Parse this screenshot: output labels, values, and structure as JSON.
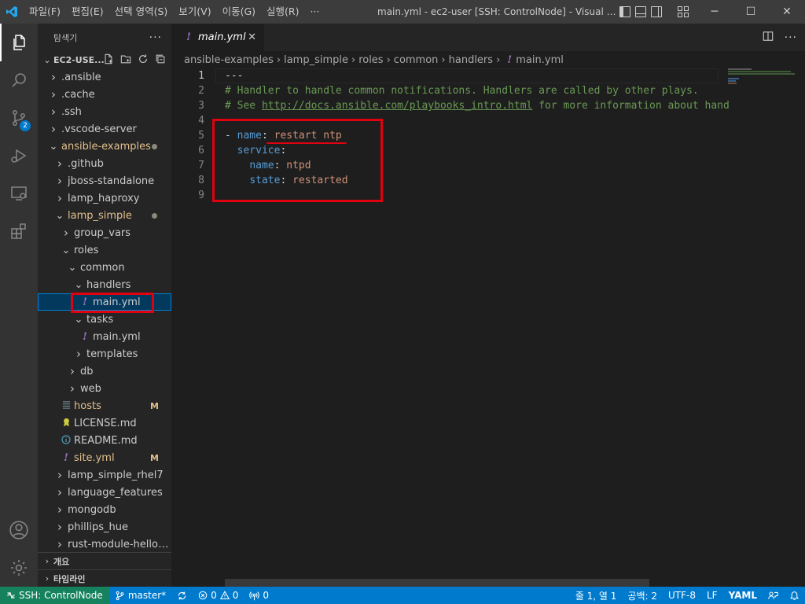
{
  "window": {
    "title": "main.yml - ec2-user [SSH: ControlNode] - Visual St...",
    "menus": [
      "파일(F)",
      "편집(E)",
      "선택 영역(S)",
      "보기(V)",
      "이동(G)",
      "실행(R)",
      "···"
    ],
    "controls": {
      "minimize": "─",
      "maximize": "☐",
      "close": "✕"
    }
  },
  "activity": {
    "source_control_badge": "2"
  },
  "sidebar": {
    "title": "탐색기",
    "more": "···",
    "folder": "EC2-USE...",
    "tree": [
      {
        "label": ".ansible",
        "depth": 0,
        "kind": "folder",
        "open": false
      },
      {
        "label": ".cache",
        "depth": 0,
        "kind": "folder",
        "open": false
      },
      {
        "label": ".ssh",
        "depth": 0,
        "kind": "folder",
        "open": false
      },
      {
        "label": ".vscode-server",
        "depth": 0,
        "kind": "folder",
        "open": false
      },
      {
        "label": "ansible-examples",
        "depth": 0,
        "kind": "folder",
        "open": true,
        "modified": true,
        "dot": true
      },
      {
        "label": ".github",
        "depth": 1,
        "kind": "folder",
        "open": false
      },
      {
        "label": "jboss-standalone",
        "depth": 1,
        "kind": "folder",
        "open": false
      },
      {
        "label": "lamp_haproxy",
        "depth": 1,
        "kind": "folder",
        "open": false
      },
      {
        "label": "lamp_simple",
        "depth": 1,
        "kind": "folder",
        "open": true,
        "modified": true,
        "dot": true
      },
      {
        "label": "group_vars",
        "depth": 2,
        "kind": "folder",
        "open": false
      },
      {
        "label": "roles",
        "depth": 2,
        "kind": "folder",
        "open": true
      },
      {
        "label": "common",
        "depth": 3,
        "kind": "folder",
        "open": true
      },
      {
        "label": "handlers",
        "depth": 4,
        "kind": "folder",
        "open": true
      },
      {
        "label": "main.yml",
        "depth": 5,
        "kind": "yaml",
        "selected": true
      },
      {
        "label": "tasks",
        "depth": 4,
        "kind": "folder",
        "open": true
      },
      {
        "label": "main.yml",
        "depth": 5,
        "kind": "yaml"
      },
      {
        "label": "templates",
        "depth": 4,
        "kind": "folder",
        "open": false
      },
      {
        "label": "db",
        "depth": 3,
        "kind": "folder",
        "open": false
      },
      {
        "label": "web",
        "depth": 3,
        "kind": "folder",
        "open": false
      },
      {
        "label": "hosts",
        "depth": 2,
        "kind": "hosts",
        "modified": true,
        "status": "M"
      },
      {
        "label": "LICENSE.md",
        "depth": 2,
        "kind": "license"
      },
      {
        "label": "README.md",
        "depth": 2,
        "kind": "info"
      },
      {
        "label": "site.yml",
        "depth": 2,
        "kind": "yaml",
        "modified": true,
        "status": "M"
      },
      {
        "label": "lamp_simple_rhel7",
        "depth": 1,
        "kind": "folder",
        "open": false
      },
      {
        "label": "language_features",
        "depth": 1,
        "kind": "folder",
        "open": false
      },
      {
        "label": "mongodb",
        "depth": 1,
        "kind": "folder",
        "open": false
      },
      {
        "label": "phillips_hue",
        "depth": 1,
        "kind": "folder",
        "open": false
      },
      {
        "label": "rust-module-hello-...",
        "depth": 1,
        "kind": "folder",
        "open": false
      }
    ],
    "outline": "개요",
    "timeline": "타임라인"
  },
  "editor": {
    "tab_label": "main.yml",
    "tab_close": "✕",
    "breadcrumb": [
      "ansible-examples",
      "lamp_simple",
      "roles",
      "common",
      "handlers",
      "main.yml"
    ],
    "lines": [
      {
        "n": "1",
        "parts": [
          {
            "t": "---",
            "c": "punc"
          }
        ]
      },
      {
        "n": "2",
        "parts": [
          {
            "t": "# Handler to handle common notifications. Handlers are called by other plays.",
            "c": "comment"
          }
        ]
      },
      {
        "n": "3",
        "parts": [
          {
            "t": "# See ",
            "c": "comment"
          },
          {
            "t": "http://docs.ansible.com/playbooks_intro.html",
            "c": "link"
          },
          {
            "t": " for more information about hand",
            "c": "comment"
          }
        ]
      },
      {
        "n": "4",
        "parts": []
      },
      {
        "n": "5",
        "parts": [
          {
            "t": "- ",
            "c": "punc"
          },
          {
            "t": "name",
            "c": "key"
          },
          {
            "t": ": ",
            "c": "punc"
          },
          {
            "t": "restart ntp",
            "c": "str"
          }
        ]
      },
      {
        "n": "6",
        "parts": [
          {
            "t": "  ",
            "c": "punc"
          },
          {
            "t": "service",
            "c": "key"
          },
          {
            "t": ":",
            "c": "punc"
          }
        ]
      },
      {
        "n": "7",
        "parts": [
          {
            "t": "    ",
            "c": "punc"
          },
          {
            "t": "name",
            "c": "key"
          },
          {
            "t": ": ",
            "c": "punc"
          },
          {
            "t": "ntpd",
            "c": "str"
          }
        ]
      },
      {
        "n": "8",
        "parts": [
          {
            "t": "    ",
            "c": "punc"
          },
          {
            "t": "state",
            "c": "key"
          },
          {
            "t": ": ",
            "c": "punc"
          },
          {
            "t": "restarted",
            "c": "str"
          }
        ]
      },
      {
        "n": "9",
        "parts": []
      }
    ]
  },
  "status": {
    "remote": "SSH: ControlNode",
    "branch": "master*",
    "errors": "0",
    "warnings": "0",
    "ports": "0",
    "position": "줄 1, 열 1",
    "spaces": "공백: 2",
    "encoding": "UTF-8",
    "eol": "LF",
    "language": "YAML"
  },
  "colors": {
    "accent": "#007acc",
    "annotation": "#e0000f",
    "remote": "#16825d"
  }
}
